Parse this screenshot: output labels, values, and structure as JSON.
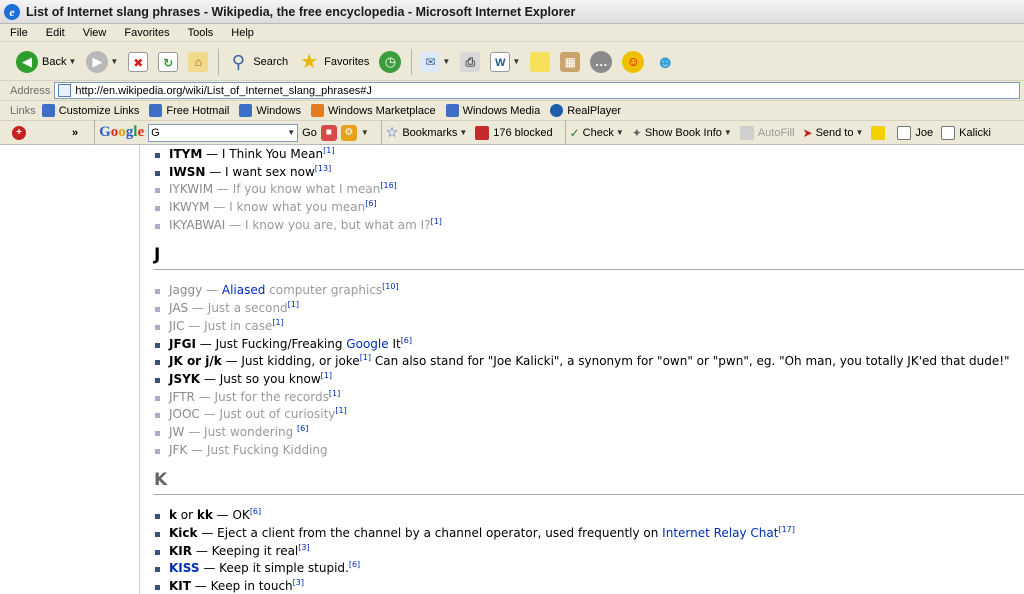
{
  "window": {
    "title": "List of Internet slang phrases - Wikipedia, the free encyclopedia - Microsoft Internet Explorer"
  },
  "menu": [
    "File",
    "Edit",
    "View",
    "Favorites",
    "Tools",
    "Help"
  ],
  "toolbar": {
    "back": "Back",
    "search": "Search",
    "favorites": "Favorites"
  },
  "address": {
    "label": "Address",
    "url": "http://en.wikipedia.org/wiki/List_of_Internet_slang_phrases#J"
  },
  "links": {
    "label": "Links",
    "items": [
      "Customize Links",
      "Free Hotmail",
      "Windows",
      "Windows Marketplace",
      "Windows Media",
      "RealPlayer"
    ]
  },
  "google_toolbar": {
    "logo": "Google",
    "search_value": "G",
    "go": "Go",
    "bookmarks": "Bookmarks",
    "blocked": "176 blocked",
    "check": "Check",
    "book_info": "Show Book Info",
    "autofill": "AutoFill",
    "send_to": "Send to",
    "joe": "Joe",
    "kalicki": "Kalicki"
  },
  "article": {
    "i_items": [
      {
        "term": "ITYM",
        "def": " — I Think You Mean",
        "ref": "[1]"
      },
      {
        "term": "IWSN",
        "def": " — I want sex now",
        "ref": "[13]"
      },
      {
        "term": "IYKWIM",
        "def": " — If you know what I mean",
        "ref": "[16]"
      },
      {
        "term": "IKWYM",
        "def": " — I know what you mean",
        "ref": "[6]"
      },
      {
        "term": "IKYABWAI",
        "def": " — I know you are, but what am I?",
        "ref": "[1]"
      }
    ],
    "section_j": "J",
    "j_items": [
      {
        "term": "Jaggy",
        "def": " — ",
        "link": "Aliased",
        "def2": " computer graphics",
        "ref": "[10]"
      },
      {
        "term": "JAS",
        "def": " — Just a second",
        "ref": "[1]"
      },
      {
        "term": "JIC",
        "def": " — Just in case",
        "ref": "[1]"
      },
      {
        "term": "JFGI",
        "def": " — Just Fucking/Freaking ",
        "link": "Google",
        "def2": " It",
        "ref": "[6]"
      },
      {
        "term": "JK or j/k",
        "def": " — Just kidding, or joke",
        "ref": "[1]",
        "def3": " Can also stand for \"Joe Kalicki\", a synonym for \"own\" or \"pwn\", eg. \"Oh man, you totally JK'ed that dude!\""
      },
      {
        "term": "JSYK",
        "def": " — Just so you know",
        "ref": "[1]"
      },
      {
        "term": "JFTR",
        "def": " — Just for the records",
        "ref": "[1]"
      },
      {
        "term": "JOOC",
        "def": " — Just out of curiosity",
        "ref": "[1]"
      },
      {
        "term": "JW",
        "def": " — Just wondering ",
        "ref": "[6]"
      },
      {
        "term": "JFK",
        "def": " — Just Fucking Kidding",
        "ref": ""
      }
    ],
    "section_k": "K",
    "k_items": [
      {
        "term": "k",
        "mid": " or ",
        "term2": "kk",
        "def": " — OK",
        "ref": "[6]"
      },
      {
        "term": "Kick",
        "def": " — Eject a client from the channel by a channel operator, used frequently on ",
        "link": "Internet Relay Chat",
        "ref": "[17]"
      },
      {
        "term": "KIR",
        "def": " — Keeping it real",
        "ref": "[3]"
      },
      {
        "term": "KISS",
        "def": " — Keep it simple stupid.",
        "ref": "[6]"
      },
      {
        "term": "KIT",
        "def": " — Keep in touch",
        "ref": "[3]"
      }
    ]
  }
}
